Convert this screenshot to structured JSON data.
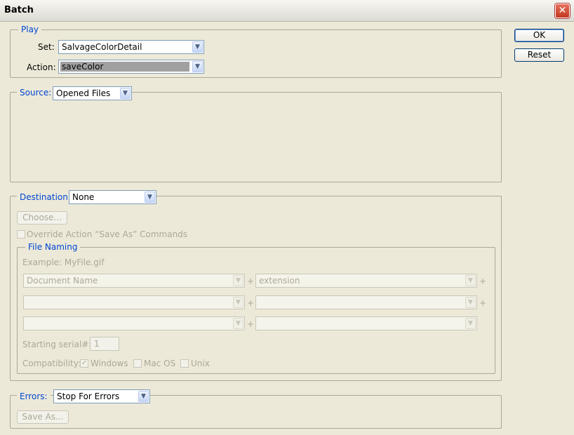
{
  "window": {
    "title": "Batch",
    "close_glyph": "✕"
  },
  "buttons": {
    "ok": "OK",
    "reset": "Reset"
  },
  "play": {
    "legend": "Play",
    "set_label": "Set:",
    "set_value": "SalvageColorDetail",
    "action_label": "Action:",
    "action_value": "saveColor"
  },
  "source": {
    "label": "Source:",
    "value": "Opened Files"
  },
  "destination": {
    "label": "Destination:",
    "value": "None",
    "choose_button": "Choose...",
    "override_checkbox": "Override Action “Save As” Commands",
    "file_naming": {
      "legend": "File Naming",
      "example": "Example: MyFile.gif",
      "rows": [
        {
          "left": "Document Name",
          "right": "extension"
        },
        {
          "left": "",
          "right": ""
        },
        {
          "left": "",
          "right": ""
        }
      ],
      "plus": "+",
      "serial_label": "Starting serial#:",
      "serial_value": "1",
      "compat_label": "Compatibility:",
      "windows": "Windows",
      "windows_checked": true,
      "macos": "Mac OS",
      "unix": "Unix"
    }
  },
  "errors": {
    "label": "Errors:",
    "value": "Stop For Errors",
    "save_as_button": "Save As..."
  },
  "icons": {
    "dropdown_arrow": "▼",
    "check": "✓"
  }
}
